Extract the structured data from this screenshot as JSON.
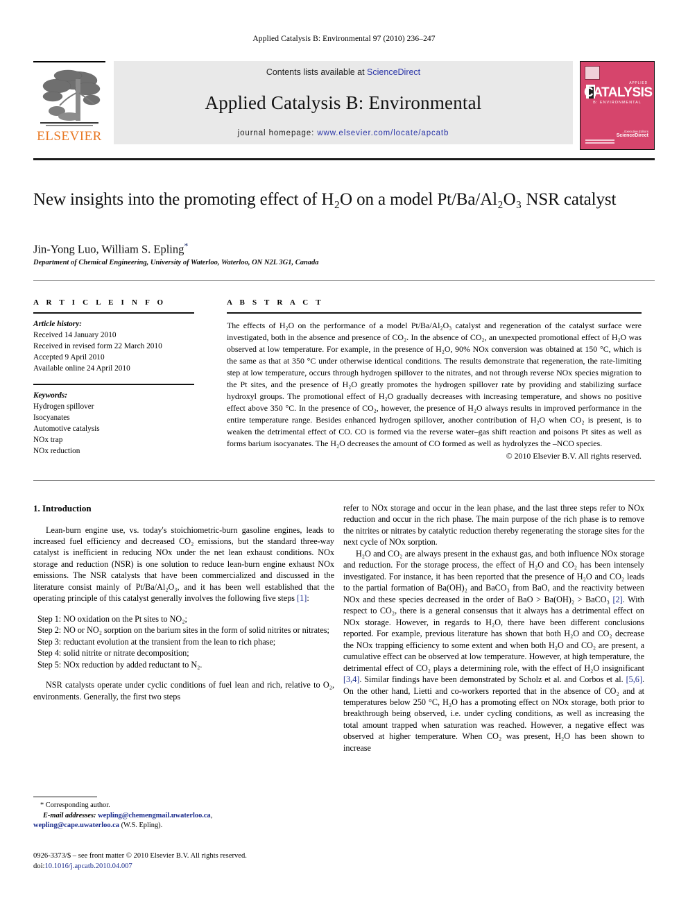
{
  "running_head": "Applied Catalysis B: Environmental 97 (2010) 236–247",
  "banner": {
    "contents_prefix": "Contents lists available at ",
    "sciencedirect": "ScienceDirect",
    "journal_title": "Applied Catalysis B: Environmental",
    "homepage_prefix": "journal homepage: ",
    "homepage_url": "www.elsevier.com/locate/apcatb",
    "publisher": "ELSEVIER",
    "cover": {
      "applied": "APPLIED",
      "catalysis": "CATALYSIS",
      "subtitle": "B: ENVIRONMENTAL",
      "editor_label": "Executive Editors",
      "sciencedirect": "ScienceDirect"
    },
    "link_color": "#2b36a8",
    "elsevier_orange": "#E87722"
  },
  "article": {
    "title": "New insights into the promoting effect of H₂O on a model Pt/Ba/Al₂O₃ NSR catalyst",
    "authors": "Jin-Yong Luo, William S. Epling",
    "affiliation": "Department of Chemical Engineering, University of Waterloo, Waterloo, ON N2L 3G1, Canada"
  },
  "article_info": {
    "heading": "A R T I C L E   I N F O",
    "history_label": "Article history:",
    "history": [
      "Received 14 January 2010",
      "Received in revised form 22 March 2010",
      "Accepted 9 April 2010",
      "Available online 24 April 2010"
    ],
    "keywords_label": "Keywords:",
    "keywords": [
      "Hydrogen spillover",
      "Isocyanates",
      "Automotive catalysis",
      "NOx trap",
      "NOx reduction"
    ]
  },
  "abstract": {
    "heading": "A B S T R A C T",
    "text": "The effects of H₂O on the performance of a model Pt/Ba/Al₂O₃ catalyst and regeneration of the catalyst surface were investigated, both in the absence and presence of CO₂. In the absence of CO₂, an unexpected promotional effect of H₂O was observed at low temperature. For example, in the presence of H₂O, 90% NOx conversion was obtained at 150 °C, which is the same as that at 350 °C under otherwise identical conditions. The results demonstrate that regeneration, the rate-limiting step at low temperature, occurs through hydrogen spillover to the nitrates, and not through reverse NOx species migration to the Pt sites, and the presence of H₂O greatly promotes the hydrogen spillover rate by providing and stabilizing surface hydroxyl groups. The promotional effect of H₂O gradually decreases with increasing temperature, and shows no positive effect above 350 °C. In the presence of CO₂, however, the presence of H₂O always results in improved performance in the entire temperature range. Besides enhanced hydrogen spillover, another contribution of H₂O when CO₂ is present, is to weaken the detrimental effect of CO. CO is formed via the reverse water–gas shift reaction and poisons Pt sites as well as forms barium isocyanates. The H₂O decreases the amount of CO formed as well as hydrolyzes the –NCO species.",
    "copyright": "© 2010 Elsevier B.V. All rights reserved."
  },
  "body": {
    "section_heading": "1. Introduction",
    "left_p1": "Lean-burn engine use, vs. today's stoichiometric-burn gasoline engines, leads to increased fuel efficiency and decreased CO₂ emissions, but the standard three-way catalyst is inefficient in reducing NOx under the net lean exhaust conditions. NOx storage and reduction (NSR) is one solution to reduce lean-burn engine exhaust NOx emissions. The NSR catalysts that have been commercialized and discussed in the literature consist mainly of Pt/Ba/Al₂O₃, and it has been well established that the operating principle of this catalyst generally involves the following five steps",
    "left_p1_ref": "[1]",
    "steps": [
      "Step 1: NO oxidation on the Pt sites to NO₂;",
      "Step 2: NO or NO₂ sorption on the barium sites in the form of solid nitrites or nitrates;",
      "Step 3: reductant evolution at the transient from the lean to rich phase;",
      "Step 4: solid nitrite or nitrate decomposition;",
      "Step 5: NOx reduction by added reductant to N₂."
    ],
    "left_p2": "NSR catalysts operate under cyclic conditions of fuel lean and rich, relative to O₂, environments. Generally, the first two steps",
    "right_p1": "refer to NOx storage and occur in the lean phase, and the last three steps refer to NOx reduction and occur in the rich phase. The main purpose of the rich phase is to remove the nitrites or nitrates by catalytic reduction thereby regenerating the storage sites for the next cycle of NOx sorption.",
    "right_p2_a": "H₂O and CO₂ are always present in the exhaust gas, and both influence NOx storage and reduction. For the storage process, the effect of H₂O and CO₂ has been intensely investigated. For instance, it has been reported that the presence of H₂O and CO₂ leads to the partial formation of Ba(OH)₂ and BaCO₃ from BaO, and the reactivity between NOx and these species decreased in the order of BaO > Ba(OH)₂ > BaCO₃ ",
    "right_ref_2": "[2]",
    "right_p2_b": ". With respect to CO₂, there is a general consensus that it always has a detrimental effect on NOx storage. However, in regards to H₂O, there have been different conclusions reported. For example, previous literature has shown that both H₂O and CO₂ decrease the NOx trapping efficiency to some extent and when both H₂O and CO₂ are present, a cumulative effect can be observed at low temperature. However, at high temperature, the detrimental effect of CO₂ plays a determining role, with the effect of H₂O insignificant ",
    "right_ref_34": "[3,4]",
    "right_p2_c": ". Similar findings have been demonstrated by Scholz et al. and Corbos et al. ",
    "right_ref_56": "[5,6]",
    "right_p2_d": ". On the other hand, Lietti and co-workers reported that in the absence of CO₂ and at temperatures below 250 °C, H₂O has a promoting effect on NOx storage, both prior to breakthrough being observed, i.e. under cycling conditions, as well as increasing the total amount trapped when saturation was reached. However, a negative effect was observed at higher temperature. When CO₂ was present, H₂O has been shown to increase"
  },
  "footnote": {
    "corresponding": "* Corresponding author.",
    "email_label": "E-mail addresses:",
    "email1": "wepling@chemengmail.uwaterloo.ca",
    "email2": "wepling@cape.uwaterloo.ca",
    "email_owner": "(W.S. Epling)."
  },
  "imprint": {
    "line1": "0926-3373/$ – see front matter © 2010 Elsevier B.V. All rights reserved.",
    "doi_label": "doi:",
    "doi": "10.1016/j.apcatb.2010.04.007"
  }
}
